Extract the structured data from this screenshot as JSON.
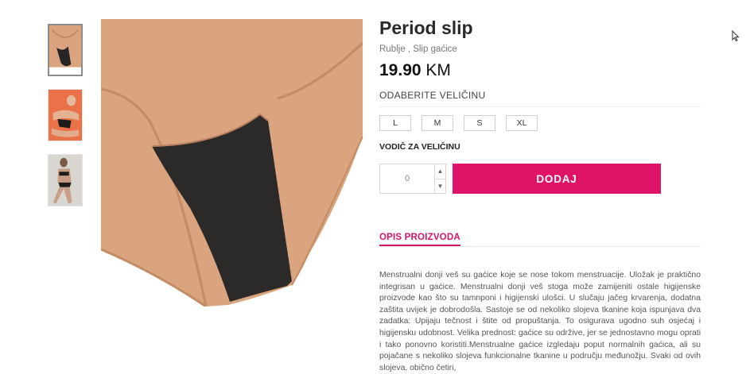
{
  "product": {
    "title": "Period slip",
    "breadcrumb": [
      "Rublje",
      "Slip gaćice"
    ],
    "breadcrumb_sep": " , ",
    "price_amount": "19.90",
    "price_currency": "KM"
  },
  "size_selector": {
    "label": "ODABERITE VELIČINU",
    "options": [
      "L",
      "M",
      "S",
      "XL"
    ],
    "guide_label": "VODIČ ZA VELIČINU"
  },
  "cart": {
    "quantity": "0",
    "add_label": "DODAJ",
    "accent_color": "#df1468"
  },
  "tabs": {
    "description_label": "OPIS PROIZVODA"
  },
  "description": "Menstrualni donji veš su gaćice koje se nose tokom menstruacije. Uložak je praktično integrisan u gaćice. Menstrualni donji veš stoga može zamijeniti ostale higijenske proizvode kao što su tamnponi i higijenski ulošci. U slučaju jačeg krvarenja, dodatna zaštita uvijek je dobrodošla. Sastoje se od nekoliko slojeva tkanine koja ispunjava dva zadatka: Upijaju tečnost i štite od propuštanja. To osigurava ugodno suh osjećaj i higijensku udobnost. Velika prednost: gaćice su održive, jer se jednostavno mogu oprati i tako ponovno koristiti.Menstrualne gaćice izgledaju poput normalnih gaćica, ali su pojačane s nekoliko slojeva funkcionalne tkanine u području međunožju. Svaki od ovih slojeva, obično četiri,",
  "icons": {
    "qty_up": "chevron-up-icon",
    "qty_down": "chevron-down-icon",
    "cursor": "mouse-cursor-icon"
  }
}
